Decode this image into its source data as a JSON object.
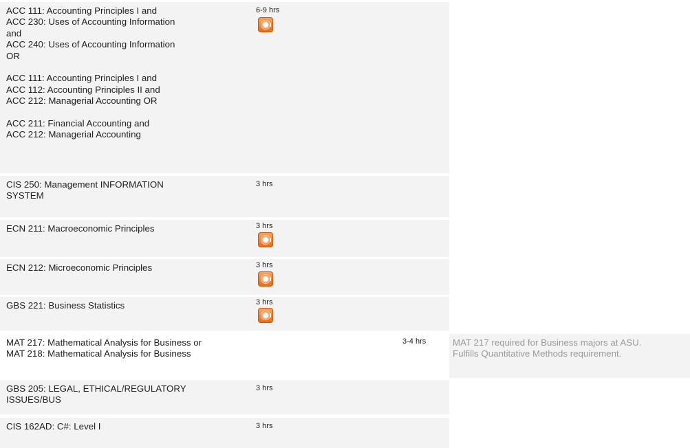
{
  "rows": [
    {
      "course": "ACC 111: Accounting Principles I and\nACC 230: Uses of Accounting Information\nand\nACC 240: Uses of Accounting Information\nOR\n\nACC 111: Accounting Principles I and\nACC 112: Accounting Principles II and\nACC 212: Managerial Accounting OR\n\nACC 211: Financial Accounting and\nACC 212: Managerial Accounting",
      "hours": "6-9 hrs",
      "icon": "audio-play-icon"
    },
    {
      "course": "CIS 250: Management INFORMATION\nSYSTEM",
      "hours": "3 hrs"
    },
    {
      "course": "ECN 211: Macroeconomic Principles",
      "hours": "3 hrs",
      "icon": "audio-play-icon"
    },
    {
      "course": "ECN 212: Microeconomic Principles",
      "hours": "3 hrs",
      "icon": "audio-play-icon"
    },
    {
      "course": "GBS 221: Business Statistics",
      "hours": "3 hrs",
      "icon": "audio-play-icon"
    },
    {
      "course": "MAT 217: Mathematical Analysis for Business or\nMAT 218: Mathematical Analysis for Business",
      "hours": "3-4 hrs",
      "note": "MAT 217 required for Business majors at ASU.\nFulfills Quantitative Methods requirement."
    },
    {
      "course": "GBS 205: LEGAL, ETHICAL/REGULATORY\nISSUES/BUS",
      "hours": "3 hrs"
    },
    {
      "course": "CIS 162AD: C#: Level I",
      "hours": "3 hrs"
    }
  ],
  "colors": {
    "row_bg": "#f3f3f3",
    "note_text": "#9a9a9a",
    "icon_orange": "#e86a18"
  }
}
